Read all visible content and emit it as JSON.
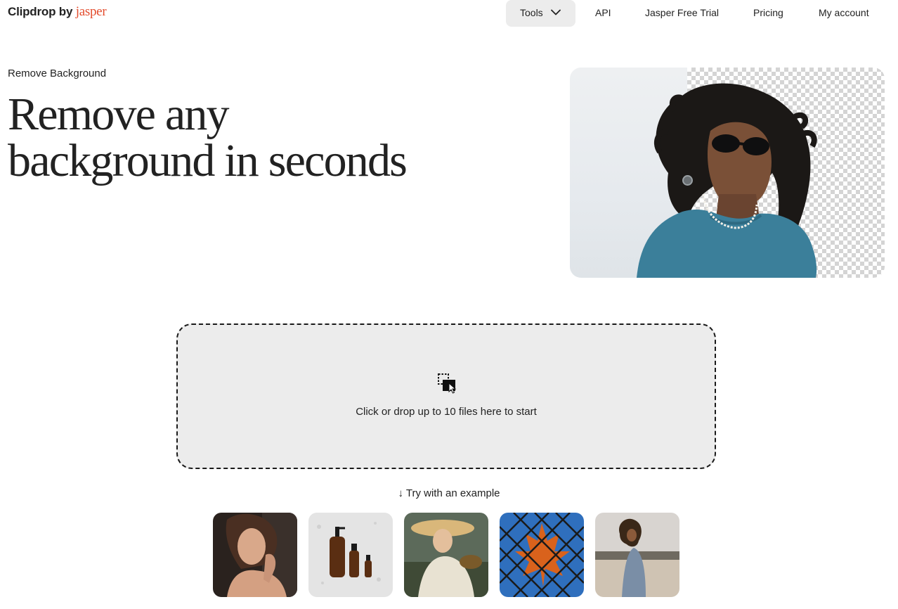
{
  "header": {
    "logo_main": "Clipdrop by",
    "logo_brand": "jasper",
    "brand_color": "#e34c2d",
    "nav": {
      "tools": "Tools",
      "api": "API",
      "trial": "Jasper Free Trial",
      "pricing": "Pricing",
      "account": "My account"
    }
  },
  "hero": {
    "eyebrow": "Remove Background",
    "headline_line1": "Remove any",
    "headline_line2": "background in seconds"
  },
  "dropzone": {
    "icon": "drop-files-icon",
    "text": "Click or drop up to 10 files here to start"
  },
  "examples": {
    "label": "↓ Try with an example",
    "items": [
      {
        "name": "example-woman-portrait"
      },
      {
        "name": "example-bottles"
      },
      {
        "name": "example-painting"
      },
      {
        "name": "example-leaf-fence"
      },
      {
        "name": "example-woman-lake"
      }
    ]
  },
  "colors": {
    "dropzone_bg": "#ececec",
    "tools_bg": "#ececec",
    "text": "#222222"
  }
}
